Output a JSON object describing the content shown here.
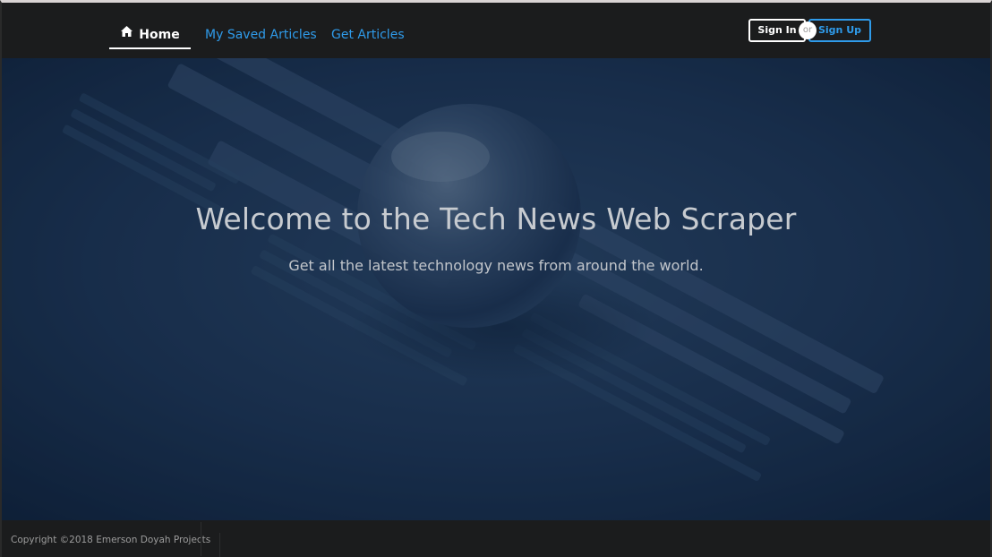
{
  "nav": {
    "home_label": "Home",
    "saved_label": "My Saved Articles",
    "get_label": "Get Articles",
    "home_icon": "home-icon"
  },
  "auth": {
    "signin_label": "Sign In",
    "or_label": "or",
    "signup_label": "Sign Up"
  },
  "hero": {
    "title": "Welcome to the Tech News Web Scraper",
    "subtitle": "Get all the latest technology news from around the world."
  },
  "footer": {
    "copyright": "Copyright ©2018 Emerson Doyah Projects"
  },
  "colors": {
    "accent": "#2f9bea",
    "navbar_bg": "#1b1c1d",
    "hero_overlay": "#0d2340"
  }
}
